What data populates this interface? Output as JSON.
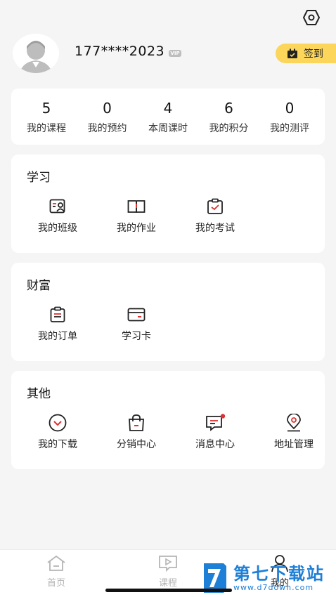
{
  "profile": {
    "username": "177****2023",
    "vip_label": "VIP",
    "checkin_label": "签到"
  },
  "stats": [
    {
      "value": "5",
      "label": "我的课程"
    },
    {
      "value": "0",
      "label": "我的预约"
    },
    {
      "value": "4",
      "label": "本周课时"
    },
    {
      "value": "6",
      "label": "我的积分"
    },
    {
      "value": "0",
      "label": "我的测评"
    }
  ],
  "study": {
    "title": "学习",
    "items": [
      {
        "label": "我的班级",
        "icon": "class-icon"
      },
      {
        "label": "我的作业",
        "icon": "homework-book-icon"
      },
      {
        "label": "我的考试",
        "icon": "exam-clipboard-icon"
      }
    ]
  },
  "wealth": {
    "title": "财富",
    "items": [
      {
        "label": "我的订单",
        "icon": "order-icon"
      },
      {
        "label": "学习卡",
        "icon": "card-icon"
      }
    ]
  },
  "other": {
    "title": "其他",
    "items": [
      {
        "label": "我的下载",
        "icon": "download-icon"
      },
      {
        "label": "分销中心",
        "icon": "shopping-bag-icon"
      },
      {
        "label": "消息中心",
        "icon": "message-icon"
      },
      {
        "label": "地址管理",
        "icon": "location-icon"
      }
    ]
  },
  "tabbar": [
    {
      "label": "首页",
      "icon": "home-icon"
    },
    {
      "label": "课程",
      "icon": "course-play-icon"
    },
    {
      "label": "我的",
      "icon": "user-icon"
    }
  ],
  "watermark": {
    "title": "第七下载站",
    "url": "www.d7down.com"
  },
  "colors": {
    "accent_red": "#e03030",
    "checkin_yellow": "#fbd65a",
    "watermark_blue": "#1e7fd6"
  }
}
